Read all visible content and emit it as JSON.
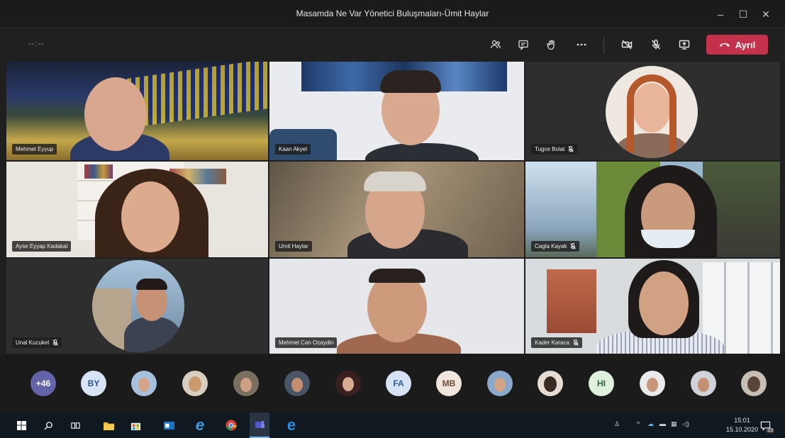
{
  "window": {
    "title": "Masamda Ne Var Yönetici Buluşmaları-Ümit Haylar",
    "controls": [
      "minimize-icon",
      "maximize-icon",
      "close-icon"
    ]
  },
  "toolbar": {
    "timer": "--:--",
    "buttons": [
      "participants-icon",
      "chat-icon",
      "raise-hand-icon",
      "more-options-icon",
      "camera-off-icon",
      "mic-off-icon",
      "share-screen-icon"
    ],
    "leave_label": "Ayrıl",
    "leave_color": "#c4314b"
  },
  "tiles": [
    {
      "name": "Mehmet Eyyup"
    },
    {
      "name": "Kaan Akyel"
    },
    {
      "name": "Tugce Bolat"
    },
    {
      "name": "Ayse Eyyap Kadakal"
    },
    {
      "name": "Umit Haylar"
    },
    {
      "name": "Cagla Kayak"
    },
    {
      "name": "Unal Kucukel"
    },
    {
      "name": "Mehmet Can Ozaydin"
    },
    {
      "name": "Kader Karaca"
    }
  ],
  "strip": {
    "overflow_count": "+46",
    "avatars": [
      {
        "initials": "BY",
        "bg": "#d7e4f5",
        "fg": "#33508f"
      },
      {
        "icon": "person-photo"
      },
      {
        "icon": "person-photo"
      },
      {
        "icon": "person-photo"
      },
      {
        "icon": "person-photo"
      },
      {
        "icon": "person-photo"
      },
      {
        "initials": "FA",
        "bg": "#d6e3f4",
        "fg": "#2f5c9c"
      },
      {
        "initials": "MB",
        "bg": "#f1e6de",
        "fg": "#6b4a36"
      },
      {
        "icon": "person-photo"
      },
      {
        "icon": "person-photo"
      },
      {
        "initials": "HI",
        "bg": "#dff0df",
        "fg": "#2d6b35"
      },
      {
        "icon": "person-photo"
      },
      {
        "icon": "person-photo"
      },
      {
        "icon": "person-photo"
      }
    ]
  },
  "taskbar": {
    "time": "15:01",
    "date": "15.10.2020",
    "notification_count": "23"
  }
}
